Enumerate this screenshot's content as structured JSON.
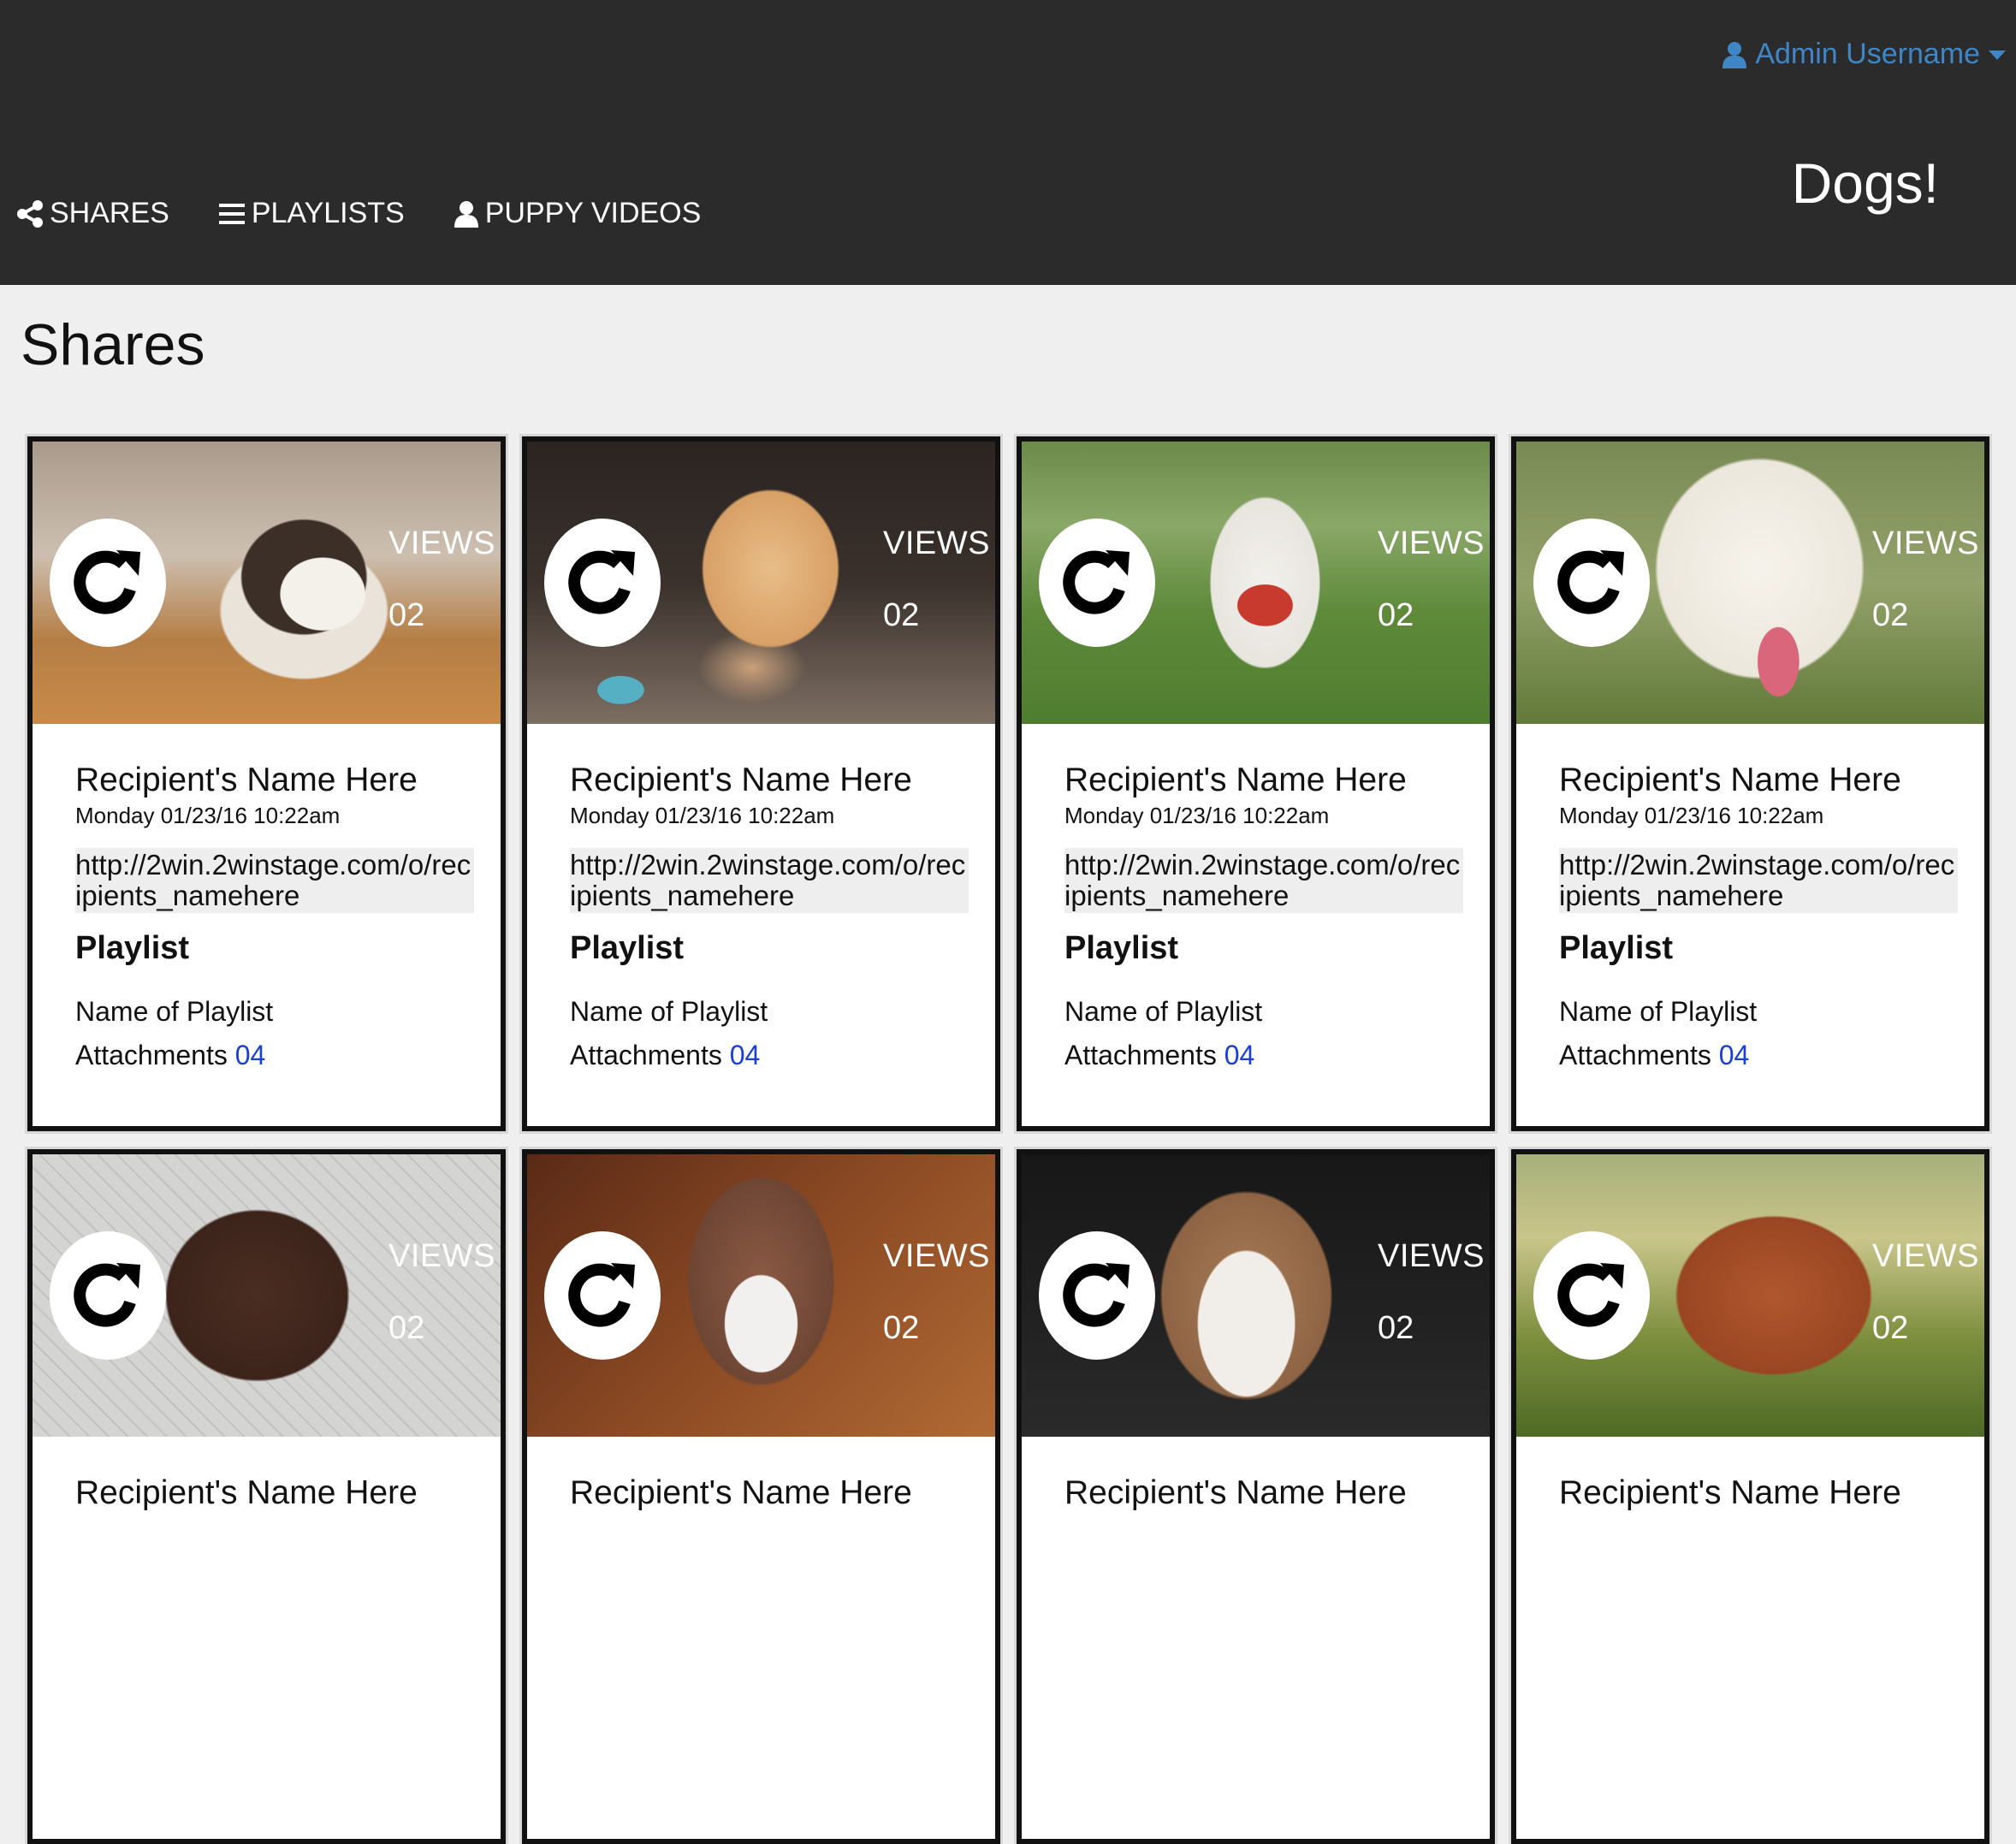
{
  "header": {
    "user_label": "Admin Username",
    "user_icon": "user-icon",
    "caret_icon": "caret-down-icon",
    "site_title": "Dogs!",
    "nav": [
      {
        "label": "SHARES",
        "icon": "share-icon"
      },
      {
        "label": "PLAYLISTS",
        "icon": "menu-icon"
      },
      {
        "label": "PUPPY VIDEOS",
        "icon": "user-icon"
      }
    ]
  },
  "page": {
    "title": "Shares"
  },
  "colors": {
    "header_bg": "#2b2b2b",
    "link_blue": "#3f86c6",
    "count_blue": "#1a3fd6",
    "page_bg": "#efefef"
  },
  "cards": [
    {
      "recipient": "Recipient's Name Here",
      "date": "Monday 01/23/16 10:22am",
      "link": "http://2win.2winstage.com/o/recipients_namehere",
      "views_label": "VIEWS",
      "views": "02",
      "playlist_heading": "Playlist",
      "playlist_name": "Name of Playlist",
      "attachments_label": "Attachments",
      "attachments_count": "04",
      "photo": "corgi-puppy-photo"
    },
    {
      "recipient": "Recipient's Name Here",
      "date": "Monday 01/23/16 10:22am",
      "link": "http://2win.2winstage.com/o/recipients_namehere",
      "views_label": "VIEWS",
      "views": "02",
      "playlist_heading": "Playlist",
      "playlist_name": "Name of Playlist",
      "attachments_label": "Attachments",
      "attachments_count": "04",
      "photo": "golden-puppy-photo"
    },
    {
      "recipient": "Recipient's Name Here",
      "date": "Monday 01/23/16 10:22am",
      "link": "http://2win.2winstage.com/o/recipients_namehere",
      "views_label": "VIEWS",
      "views": "02",
      "playlist_heading": "Playlist",
      "playlist_name": "Name of Playlist",
      "attachments_label": "Attachments",
      "attachments_count": "04",
      "photo": "white-terrier-photo"
    },
    {
      "recipient": "Recipient's Name Here",
      "date": "Monday 01/23/16 10:22am",
      "link": "http://2win.2winstage.com/o/recipients_namehere",
      "views_label": "VIEWS",
      "views": "02",
      "playlist_heading": "Playlist",
      "playlist_name": "Name of Playlist",
      "attachments_label": "Attachments",
      "attachments_count": "04",
      "photo": "white-retriever-puppy-photo"
    },
    {
      "recipient": "Recipient's Name Here",
      "views_label": "VIEWS",
      "views": "02",
      "photo": "chocolate-lab-puppy-photo"
    },
    {
      "recipient": "Recipient's Name Here",
      "views_label": "VIEWS",
      "views": "02",
      "photo": "husky-photo"
    },
    {
      "recipient": "Recipient's Name Here",
      "views_label": "VIEWS",
      "views": "02",
      "photo": "boxer-mix-photo"
    },
    {
      "recipient": "Recipient's Name Here",
      "views_label": "VIEWS",
      "views": "02",
      "photo": "red-setter-photo"
    }
  ]
}
